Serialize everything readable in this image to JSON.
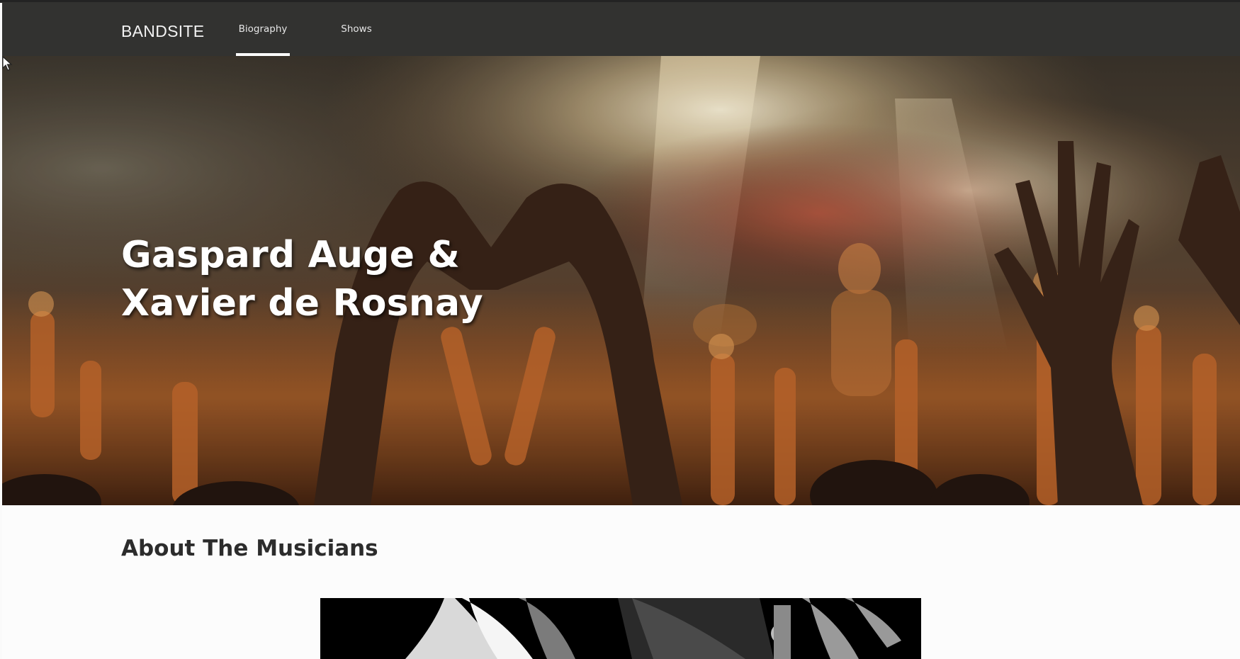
{
  "nav": {
    "logo": "BANDSITE",
    "links": [
      {
        "label": "Biography",
        "active": true
      },
      {
        "label": "Shows",
        "active": false
      }
    ]
  },
  "hero": {
    "title_line1": "Gaspard Auge &",
    "title_line2": "Xavier de Rosnay"
  },
  "about": {
    "title": "About The Musicians"
  },
  "colors": {
    "nav_bg": "#323230",
    "active_underline": "#ffffff",
    "heading_text": "#2c2c2c"
  }
}
